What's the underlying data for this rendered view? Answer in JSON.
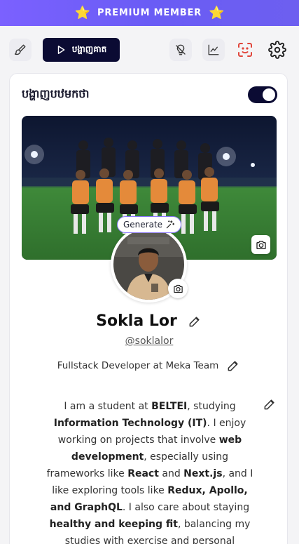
{
  "banner": {
    "text": "PREMIUM MEMBER",
    "star": "⭐"
  },
  "toolbar": {
    "preview_label": "បង្ហាញគាត",
    "icons": [
      "paint-brush-icon",
      "play-icon",
      "lightbulb-icon",
      "analytics-icon",
      "scan-icon",
      "gear-icon"
    ]
  },
  "card": {
    "title": "បង្ហាញបឋមកថា",
    "toggle_on": true
  },
  "generate_label": "Generate",
  "profile": {
    "name": "Sokla Lor",
    "username": "@soklalor",
    "role": "Fullstack Developer at Meka Team"
  },
  "bio": {
    "p1": "I am a student at ",
    "b1": "BELTEI",
    "p2": ", studying ",
    "b2": "Information Technology (IT)",
    "p3": ". I enjoy working on projects that involve ",
    "b3": "web development",
    "p4": ", especially using frameworks like ",
    "b4": "React",
    "p5": " and ",
    "b5": "Next.js",
    "p6": ", and I like exploring tools like ",
    "b6": "Redux, Apollo, and GraphQL",
    "p7": ". I also care about staying ",
    "b7": "healthy and keeping fit",
    "p8": ", balancing my studies with exercise and personal"
  },
  "colors": {
    "banner": "#7b61ff",
    "star": "#ffc928",
    "primary": "#0b0b33",
    "scan_icon": "#e0463c",
    "generate_border": "#8b78ff"
  }
}
